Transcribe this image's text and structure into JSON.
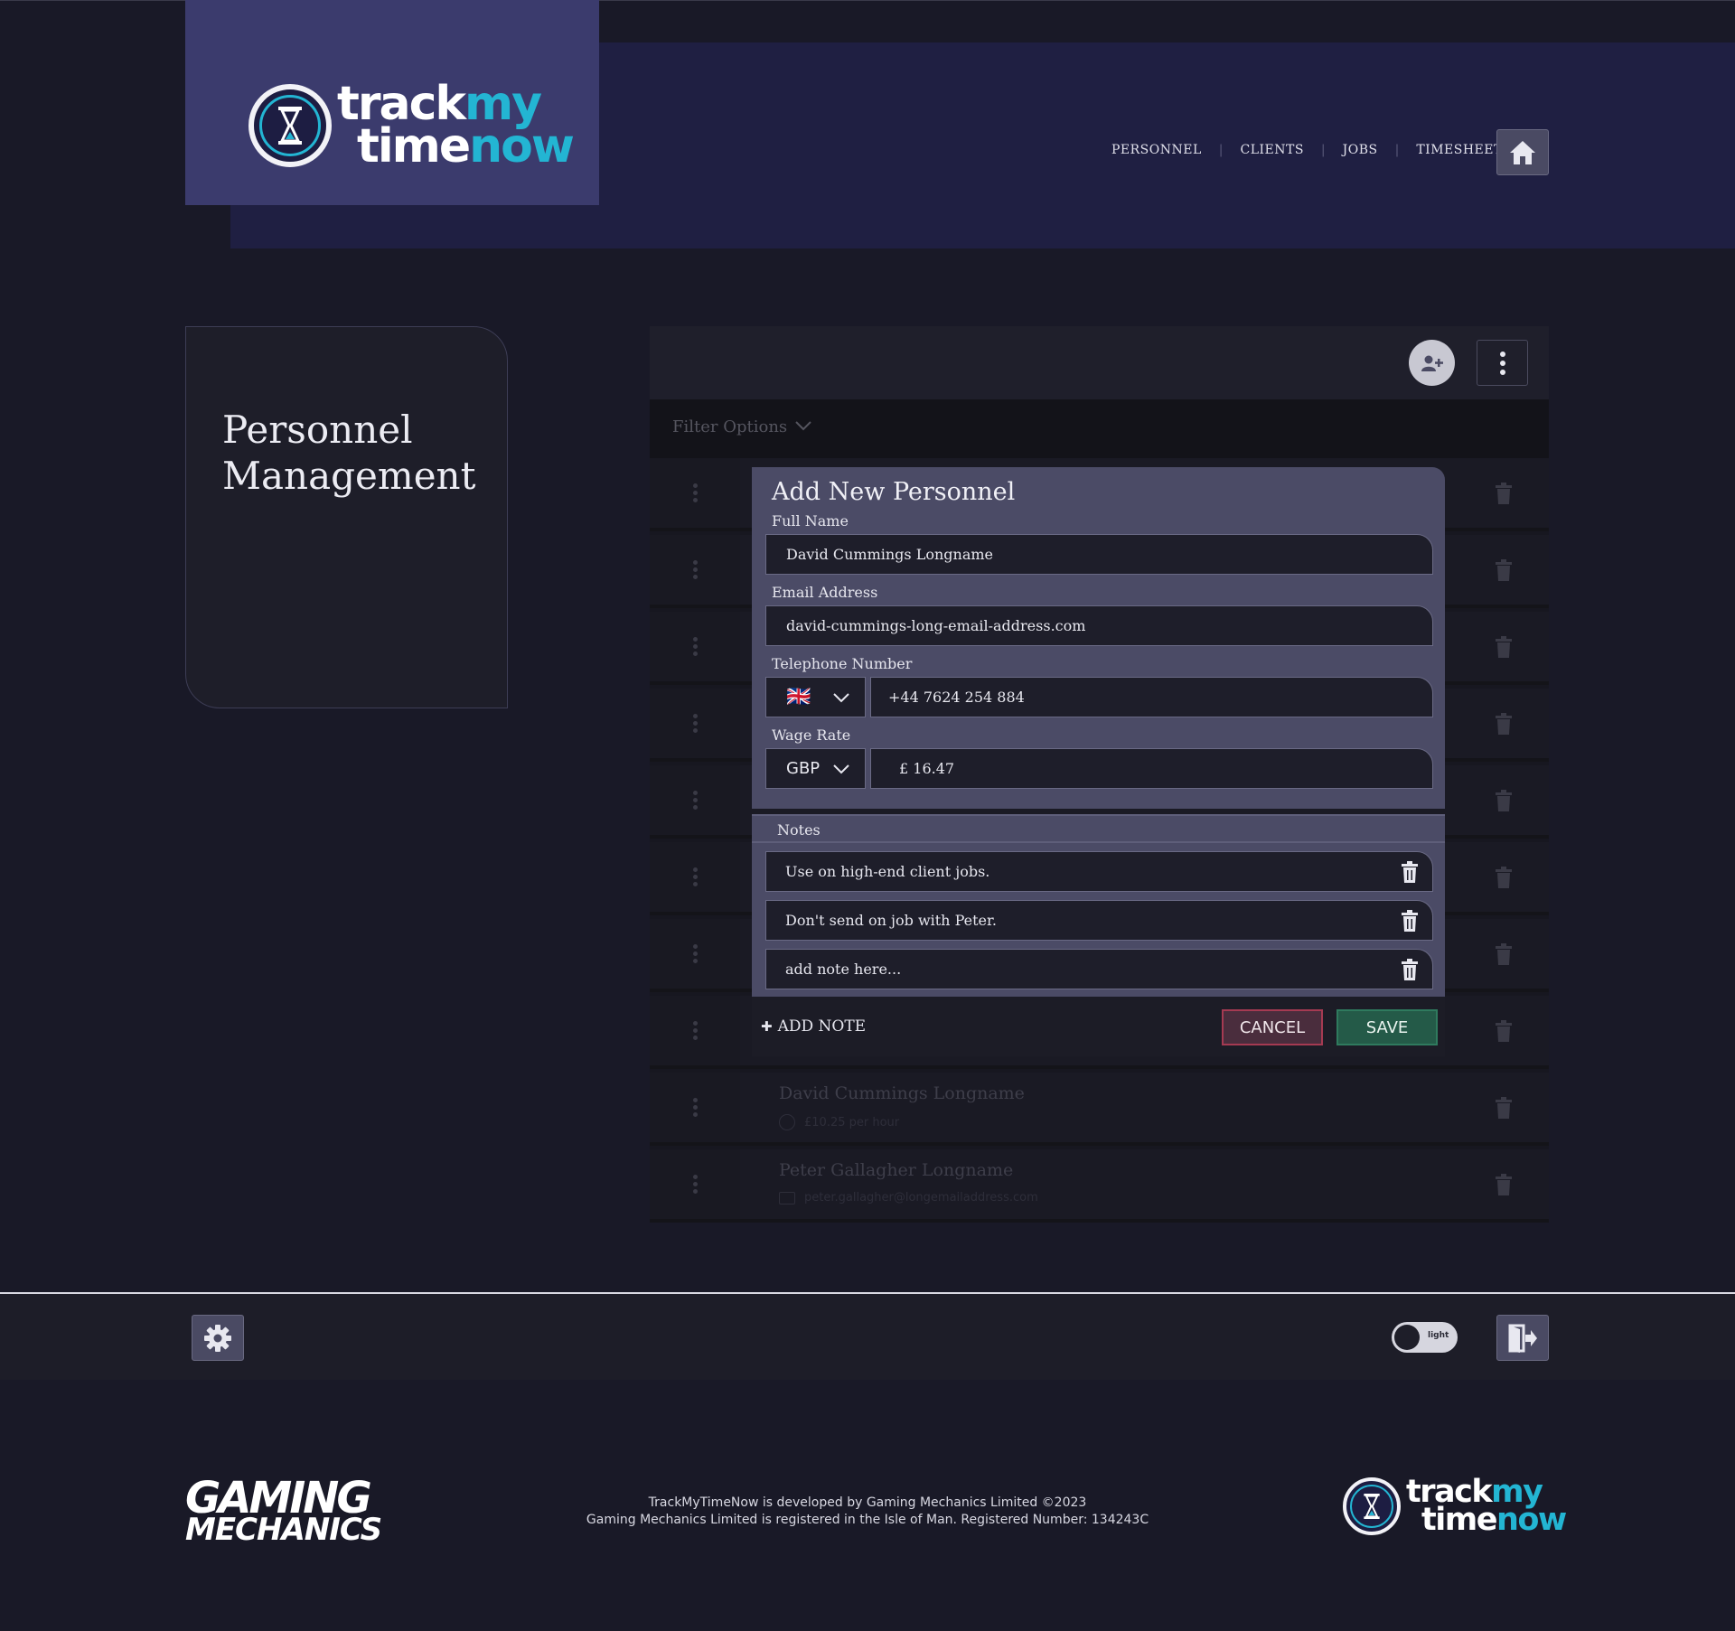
{
  "header": {
    "logo": {
      "word1": "track",
      "word2": "my",
      "word3": "time",
      "word4": "now"
    },
    "nav": [
      "PERSONNEL",
      "CLIENTS",
      "JOBS",
      "TIMESHEETS"
    ]
  },
  "page": {
    "title_line1": "Personnel",
    "title_line2": "Management"
  },
  "filter": {
    "label": "Filter Options"
  },
  "rows": [
    {
      "name": "David Cummings Longname",
      "detail": "£10.25 per hour"
    },
    {
      "name": "Peter Gallagher Longname",
      "detail": "peter.gallagher@longemailaddress.com"
    }
  ],
  "modal": {
    "title": "Add New Personnel",
    "full_name_label": "Full Name",
    "full_name_value": "David Cummings Longname",
    "email_label": "Email Address",
    "email_value": "david-cummings-long-email-address.com",
    "phone_label": "Telephone Number",
    "phone_flag": "🇬🇧",
    "phone_value": "+44 7624 254 884",
    "wage_label": "Wage Rate",
    "currency": "GBP",
    "wage_value": "£ 16.47",
    "notes_label": "Notes",
    "notes": [
      "Use on high-end client jobs.",
      "Don't send on job with Peter.",
      "add note here..."
    ],
    "add_note": "ADD NOTE",
    "cancel": "CANCEL",
    "save": "SAVE"
  },
  "bottom": {
    "theme_toggle": "light"
  },
  "footer": {
    "company_logo_line1": "GAMING",
    "company_logo_line2": "MECHANICS",
    "text_line1": "TrackMyTimeNow is developed by Gaming Mechanics Limited ©2023",
    "text_line2": "Gaming Mechanics Limited is registered in the Isle of Man. Registered Number: 134243C"
  },
  "colors": {
    "accent": "#23b5d3",
    "nav_bg": "#1f1f42",
    "logo_bg": "#3b3b6d",
    "modal_bg": "#4b4b66",
    "cancel": "#a53a52",
    "save": "#245a48"
  }
}
